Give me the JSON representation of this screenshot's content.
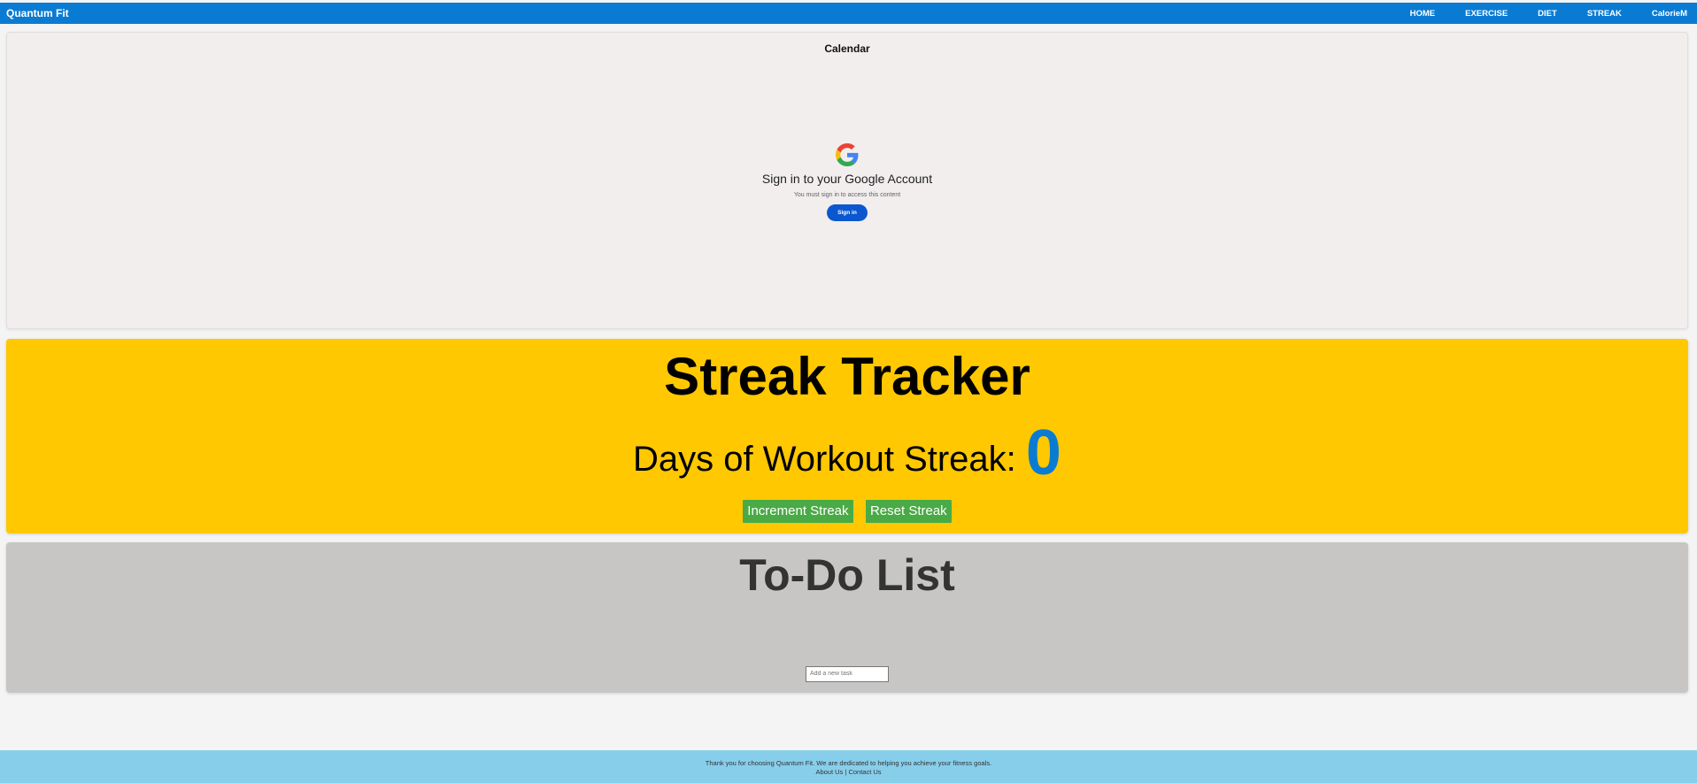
{
  "nav": {
    "brand": "Quantum Fit",
    "links": [
      "HOME",
      "EXERCISE",
      "DIET",
      "STREAK",
      "CalorieM"
    ]
  },
  "calendar": {
    "title": "Calendar",
    "google_signin": {
      "heading": "Sign in to your Google Account",
      "subtext": "You must sign in to access this content",
      "button_label": "Sign in"
    }
  },
  "streak": {
    "title": "Streak Tracker",
    "days_label": "Days of Workout Streak:",
    "count": "0",
    "increment_label": "Increment Streak",
    "reset_label": "Reset Streak"
  },
  "todo": {
    "title": "To-Do List",
    "input_placeholder": "Add a new task"
  },
  "footer": {
    "message": "Thank you for choosing Quantum Fit. We are dedicated to helping you achieve your fitness goals.",
    "about_label": "About Us",
    "separator": "|",
    "contact_label": "Contact Us"
  },
  "colors": {
    "nav_bg": "#0a7bd3",
    "streak_bg": "#ffc800",
    "streak_count": "#0a7bd3",
    "button_green": "#4aaa46",
    "todo_bg": "#c7c6c5",
    "footer_bg": "#87ceeb",
    "google_button": "#0b57d0"
  },
  "icons": {
    "google_logo": "google-logo-icon"
  }
}
